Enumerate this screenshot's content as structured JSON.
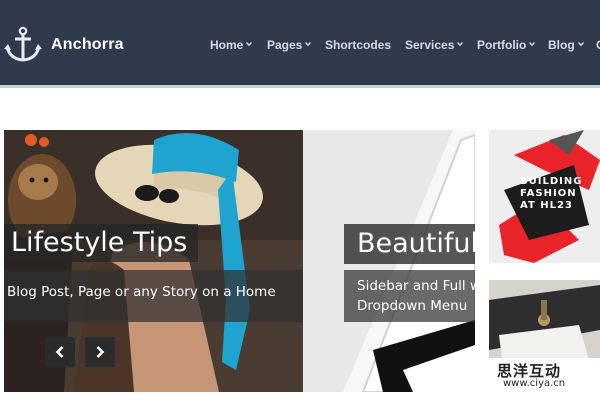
{
  "header": {
    "brand": "Anchorra",
    "logo_icon": "anchor-icon",
    "nav": [
      {
        "label": "Home",
        "dropdown": true
      },
      {
        "label": "Pages",
        "dropdown": true
      },
      {
        "label": "Shortcodes",
        "dropdown": false
      },
      {
        "label": "Services",
        "dropdown": true
      },
      {
        "label": "Portfolio",
        "dropdown": true
      },
      {
        "label": "Blog",
        "dropdown": true
      },
      {
        "label": "C",
        "dropdown": false
      }
    ]
  },
  "slider": {
    "slides": [
      {
        "title": "Lifestyle Tips",
        "text": "Blog Post, Page or any Story on a Home"
      },
      {
        "title": "Beautiful",
        "text_line1": "Sidebar and Full w",
        "text_line2": "Dropdown Menu"
      }
    ],
    "prev_icon": "chevron-left-icon",
    "next_icon": "chevron-right-icon"
  },
  "thumbs": {
    "fashion_lines": [
      "BUILDING",
      "FASHION",
      "AT HL23"
    ]
  },
  "watermark": {
    "cn": "思洋互动",
    "url": "www.ciya.cn"
  },
  "colors": {
    "header_bg": "#2f3b4c",
    "nav_text": "#d3d9e2",
    "accent_red": "#e8232a"
  }
}
